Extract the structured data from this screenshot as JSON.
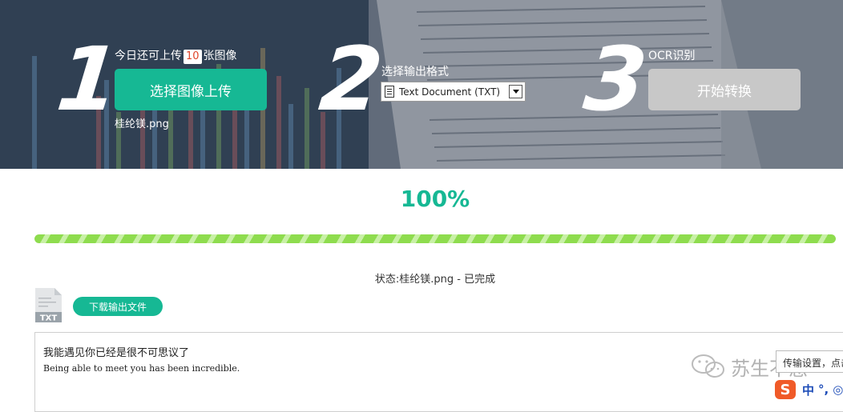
{
  "steps": {
    "step1": {
      "number": "1",
      "label_prefix": "今日还可上传",
      "remaining_count": "10",
      "label_suffix": "张图像",
      "upload_button": "选择图像上传",
      "filename": "桂纶镁.png"
    },
    "step2": {
      "number": "2",
      "label": "选择输出格式",
      "selected_format": "Text Document (TXT)"
    },
    "step3": {
      "number": "3",
      "label": "OCR识别",
      "convert_button": "开始转换"
    }
  },
  "progress": {
    "text": "100%",
    "value": 1.0,
    "fill_color": "#8edc4e"
  },
  "status": "状态:桂纶镁.png - 已完成",
  "output": {
    "file_icon_label": "TXT",
    "download_button": "下载输出文件",
    "result_cn": "我能遇见你已经是很不可思议了",
    "result_en": "Being able to meet you has been incredible."
  },
  "overlay": {
    "watermark_text": "苏生不惑",
    "ime_tooltip": "传输设置，点击",
    "ime_logo": "S",
    "ime_mode": "中",
    "ime_punct": "°,",
    "ime_misc": "◎"
  },
  "colors": {
    "accent": "#16b894",
    "disabled": "#c8c8c8",
    "count_highlight": "#e0442a"
  }
}
